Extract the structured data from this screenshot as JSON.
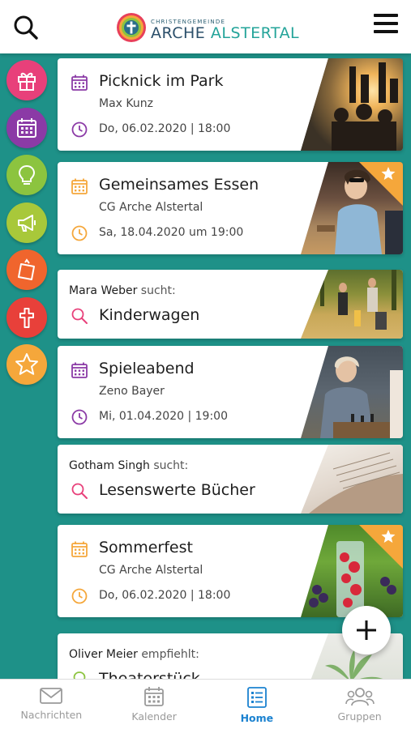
{
  "header": {
    "logo_small": "CHRISTENGEMEINDE",
    "logo_word_1": "ARCHE",
    "logo_word_2": "ALSTERTAL"
  },
  "rail": [
    {
      "icon": "gift-icon",
      "color": "#e8407a"
    },
    {
      "icon": "calendar-icon",
      "color": "#8b3aa6"
    },
    {
      "icon": "lightbulb-icon",
      "color": "#8cc43f"
    },
    {
      "icon": "megaphone-icon",
      "color": "#a8c83a"
    },
    {
      "icon": "note-icon",
      "color": "#f0652d"
    },
    {
      "icon": "cross-icon",
      "color": "#e8403a"
    },
    {
      "icon": "star-icon",
      "color": "#f5a73b"
    }
  ],
  "feed": {
    "event1": {
      "title": "Picknick im Park",
      "host": "Max Kunz",
      "date": "Do, 06.02.2020 | 18:00"
    },
    "event2": {
      "title": "Gemeinsames Essen",
      "host": "CG Arche Alstertal",
      "date": "Sa, 18.04.2020 um 19:00"
    },
    "search1": {
      "person": "Mara Weber",
      "verb": "sucht:",
      "item": "Kinderwagen"
    },
    "event3": {
      "title": "Spieleabend",
      "host": "Zeno Bayer",
      "date": "Mi, 01.04.2020 | 19:00"
    },
    "search2": {
      "person": "Gotham Singh",
      "verb": "sucht:",
      "item": "Lesenswerte Bücher"
    },
    "event4": {
      "title": "Sommerfest",
      "host": "CG Arche Alstertal",
      "date": "Do, 06.02.2020 | 18:00"
    },
    "recommend": {
      "person": "Oliver Meier",
      "verb": "empfiehlt:",
      "item": "Theaterstück"
    }
  },
  "colors": {
    "purple": "#8b3aa6",
    "orange": "#f5a73b",
    "pink": "#e8407a",
    "teal": "#1e9188",
    "active": "#1b82d0"
  },
  "tabs": [
    {
      "label": "Nachrichten",
      "icon": "mail-icon"
    },
    {
      "label": "Kalender",
      "icon": "calendar-icon"
    },
    {
      "label": "Home",
      "icon": "home-list-icon"
    },
    {
      "label": "Gruppen",
      "icon": "group-icon"
    }
  ]
}
